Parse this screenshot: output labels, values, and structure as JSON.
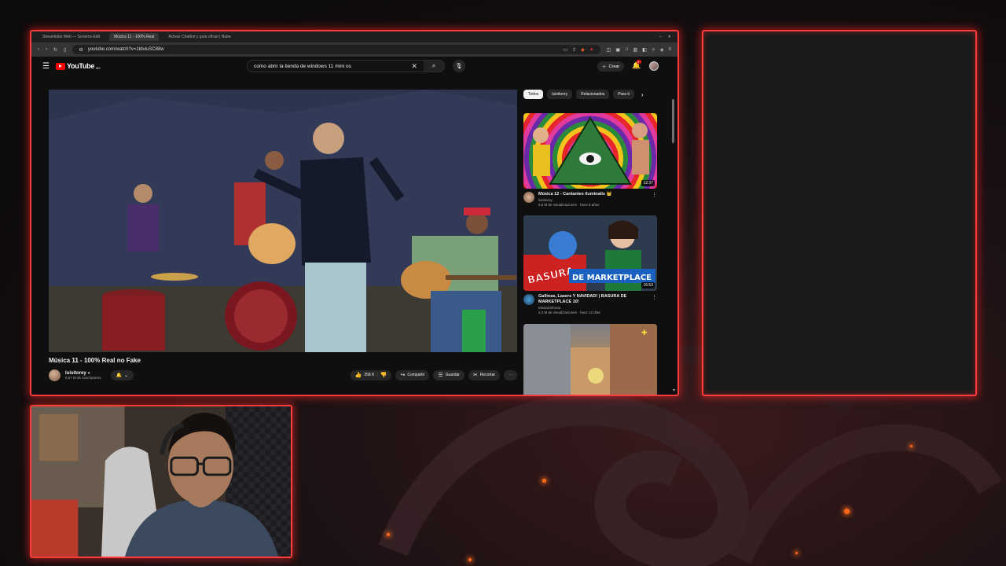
{
  "browser": {
    "tabs": [
      {
        "label": "Streamlabs Web — Screens Edit"
      },
      {
        "label": "Música 11 - 100% Real"
      },
      {
        "label": "Activar Chatbot y guía oficial | Nube"
      }
    ],
    "url": "youtube.com/watch?v=1tdviuSC88w"
  },
  "youtube": {
    "logo": "YouTube",
    "region": "MX",
    "search_value": "como abrir la tienda de windows 11 mini os",
    "create_label": "Crear",
    "notification_count": "9+",
    "video": {
      "title": "Música 11 - 100% Real no Fake",
      "channel": "luisitorey",
      "subscribers": "6,57 M de suscriptores",
      "likes": "258 K",
      "share_label": "Compartir",
      "save_label": "Guardar",
      "clip_label": "Recortar"
    },
    "chips": [
      "Todos",
      "luisitorey",
      "Relacionados",
      "Para ti"
    ],
    "recommendations": [
      {
        "title": "Música 12 - Cantantes iluminatis 👑",
        "channel": "luisitorey",
        "meta": "6,6 M de visualizaciones · hace 8 años",
        "duration": "12:37"
      },
      {
        "title": "Gallinas, Lasers Y NAVIDAD! | BASURA DE MARKETPLACE 10!",
        "channel": "MissaSinfonia",
        "meta": "4,3 M de visualizaciones · hace 12 días",
        "duration": "16:53"
      },
      {
        "title": "",
        "channel": "",
        "meta": "",
        "duration": ""
      }
    ]
  },
  "thumbnail_text": {
    "rec2_overlay_1": "BASURA",
    "rec2_overlay_2": "DE MARKETPLACE"
  },
  "colors": {
    "frame_accent": "#ff3b3b",
    "youtube_red": "#ff0000",
    "yt_background": "#0f0f0f"
  }
}
